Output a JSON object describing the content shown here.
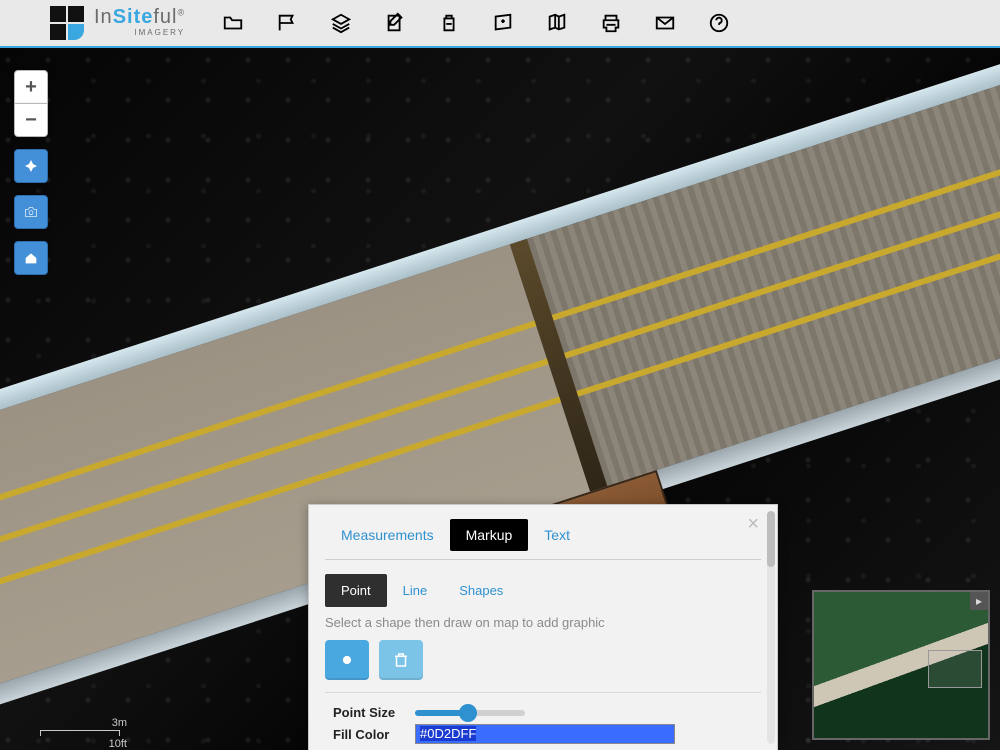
{
  "brand": {
    "name_pre": "In",
    "name_mid": "Site",
    "name_post": "ful",
    "sub": "IMAGERY",
    "reg": "®"
  },
  "toolbar_icons": [
    "folder-icon",
    "map-flag-icon",
    "layers-icon",
    "edit-note-icon",
    "backpack-icon",
    "map-pin-icon",
    "map-book-icon",
    "print-icon",
    "mail-icon",
    "help-icon"
  ],
  "map_controls": {
    "zoom_in": "+",
    "zoom_out": "−",
    "buttons": [
      "locate-icon",
      "camera-icon",
      "home-icon"
    ]
  },
  "scale": {
    "top": "3m",
    "bottom": "10ft"
  },
  "overview": {
    "collapse": "▸"
  },
  "panel": {
    "close": "×",
    "tabs1": [
      "Measurements",
      "Markup",
      "Text"
    ],
    "tabs1_active": 1,
    "tabs2": [
      "Point",
      "Line",
      "Shapes"
    ],
    "tabs2_active": 0,
    "hint": "Select a shape then draw on map to add graphic",
    "tools": [
      "point-draw-icon",
      "trash-icon"
    ],
    "point_size_label": "Point Size",
    "fill_color_label": "Fill Color",
    "fill_color_value": "#0D2DFF"
  }
}
